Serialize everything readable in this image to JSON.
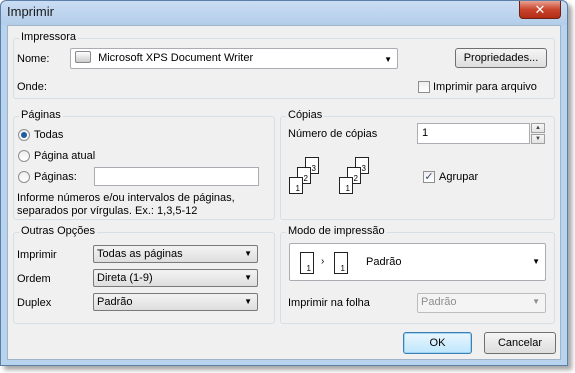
{
  "window": {
    "title": "Imprimir",
    "close_glyph": "✕"
  },
  "printer": {
    "group_label": "Impressora",
    "name_label": "Nome:",
    "name_value": "Microsoft XPS Document Writer",
    "where_label": "Onde:",
    "properties_button": "Propriedades...",
    "print_to_file_label": "Imprimir para arquivo",
    "print_to_file_checked": false
  },
  "pages": {
    "group_label": "Páginas",
    "all": "Todas",
    "current": "Página atual",
    "pages": "Páginas:",
    "pages_value": "",
    "selected": "all",
    "hint_line1": "Informe números e/ou intervalos de páginas,",
    "hint_line2": "separados por vírgulas. Ex.: 1,3,5-12"
  },
  "copies": {
    "group_label": "Cópias",
    "count_label": "Número de cópias",
    "count_value": "1",
    "collate_label": "Agrupar",
    "collate_checked": true,
    "illustration": {
      "pages": [
        "1",
        "2",
        "3",
        "1",
        "2",
        "3"
      ]
    }
  },
  "other": {
    "group_label": "Outras Opções",
    "print_label": "Imprimir",
    "print_value": "Todas as páginas",
    "order_label": "Ordem",
    "order_value": "Direta (1-9)",
    "duplex_label": "Duplex",
    "duplex_value": "Padrão"
  },
  "mode": {
    "group_label": "Modo de impressão",
    "layout_value": "Padrão",
    "layout_pages": [
      "1",
      "1"
    ],
    "per_sheet_label": "Imprimir na folha",
    "per_sheet_value": "Padrão"
  },
  "buttons": {
    "ok": "OK",
    "cancel": "Cancelar"
  },
  "colors": {
    "titlebar": "#b8d3ee",
    "dialog_bg": "#f0f0f0",
    "close": "#c9442b",
    "accent": "#1f5da1"
  }
}
